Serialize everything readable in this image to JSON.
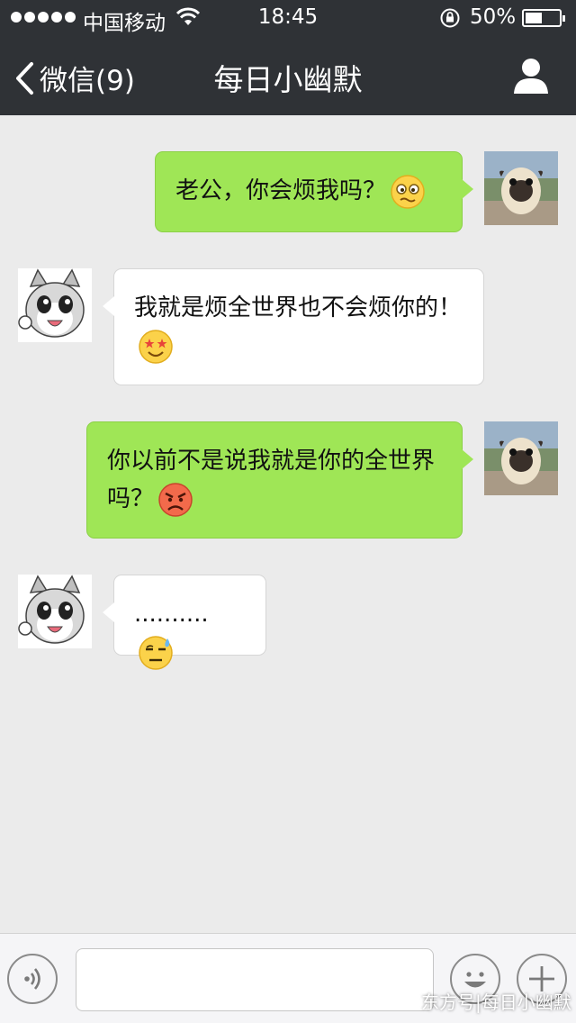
{
  "status_bar": {
    "carrier": "中国移动",
    "time": "18:45",
    "battery": "50%",
    "battery_level": 0.5
  },
  "nav": {
    "back_label": "微信(9)",
    "title": "每日小幽默"
  },
  "messages": [
    {
      "direction": "out",
      "sender": "pug",
      "text": "老公，你会烦我吗？",
      "emoji": "worried-face-emoji"
    },
    {
      "direction": "in",
      "sender": "cat",
      "text": "我就是烦全世界也不会烦你的！",
      "emoji": "starry-eyed-face-emoji"
    },
    {
      "direction": "out",
      "sender": "pug",
      "text": "你以前不是说我就是你的全世界吗？",
      "emoji": "angry-face-emoji"
    },
    {
      "direction": "in",
      "sender": "cat",
      "text": "..........",
      "emoji": "sweat-face-emoji"
    }
  ],
  "watermark": "东方号|每日小幽默",
  "colors": {
    "nav_bg": "#2f3236",
    "chat_bg": "#ebebeb",
    "outgoing_bubble": "#9fe656",
    "incoming_bubble": "#ffffff"
  }
}
